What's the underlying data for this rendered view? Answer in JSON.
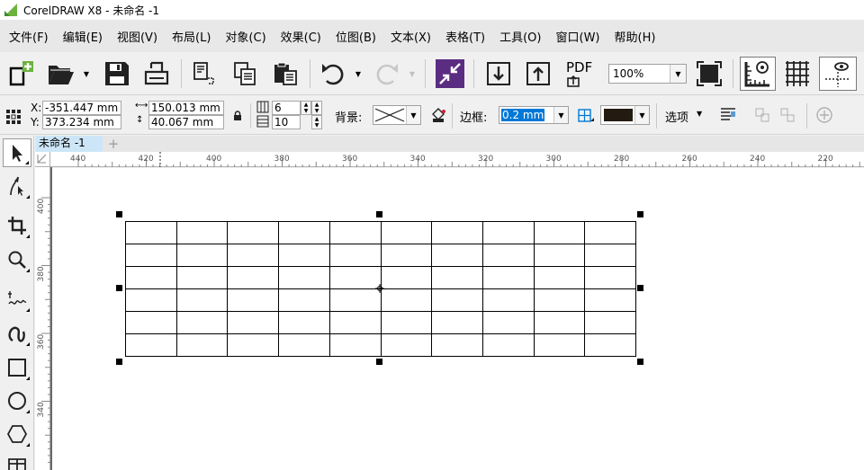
{
  "window": {
    "title": "CorelDRAW X8 - 未命名 -1"
  },
  "menu": [
    {
      "label": "文件(F)"
    },
    {
      "label": "编辑(E)"
    },
    {
      "label": "视图(V)"
    },
    {
      "label": "布局(L)"
    },
    {
      "label": "对象(C)"
    },
    {
      "label": "效果(C)"
    },
    {
      "label": "位图(B)"
    },
    {
      "label": "文本(X)"
    },
    {
      "label": "表格(T)"
    },
    {
      "label": "工具(O)"
    },
    {
      "label": "窗口(W)"
    },
    {
      "label": "帮助(H)"
    }
  ],
  "toolbar": {
    "zoom_value": "100%",
    "pdf_label": "PDF"
  },
  "propbar": {
    "x_label": "X:",
    "x_value": "-351.447 mm",
    "y_label": "Y:",
    "y_value": "373.234 mm",
    "width_value": "150.013 mm",
    "height_value": "40.067 mm",
    "rows_value": "6",
    "cols_value": "10",
    "background_label": "背景:",
    "border_label": "边框:",
    "border_width_value": "0.2 mm",
    "options_label": "选项",
    "border_color": "#231a12"
  },
  "document": {
    "tab_label": "未命名 -1"
  },
  "ruler": {
    "h_ticks": [
      "440",
      "420",
      "400",
      "380",
      "360",
      "340",
      "320",
      "300",
      "280",
      "260",
      "240",
      "220"
    ],
    "v_ticks": [
      "400",
      "380",
      "360",
      "340"
    ]
  },
  "table": {
    "rows": 6,
    "cols": 10,
    "line_color": "#000000"
  },
  "colors": {
    "selection_blue": "#0078d7",
    "tab_active": "#cde6f7",
    "logo_green": "#6cb33e",
    "effect_purple": "#5b2d82"
  },
  "icons": {
    "toolbar": [
      "new-document-icon",
      "open-folder-icon",
      "save-icon",
      "print-icon",
      "cut-icon",
      "copy-icon",
      "paste-icon",
      "undo-icon",
      "redo-icon",
      "search-content-icon",
      "import-icon",
      "export-icon",
      "publish-pdf-icon",
      "full-screen-icon",
      "show-rulers-icon",
      "show-grid-icon",
      "show-guidelines-icon"
    ],
    "toolbox": [
      "pick-tool-icon",
      "shape-tool-icon",
      "crop-tool-icon",
      "zoom-tool-icon",
      "freehand-tool-icon",
      "artistic-media-icon",
      "rectangle-tool-icon",
      "ellipse-tool-icon",
      "polygon-tool-icon",
      "table-tool-icon"
    ]
  }
}
